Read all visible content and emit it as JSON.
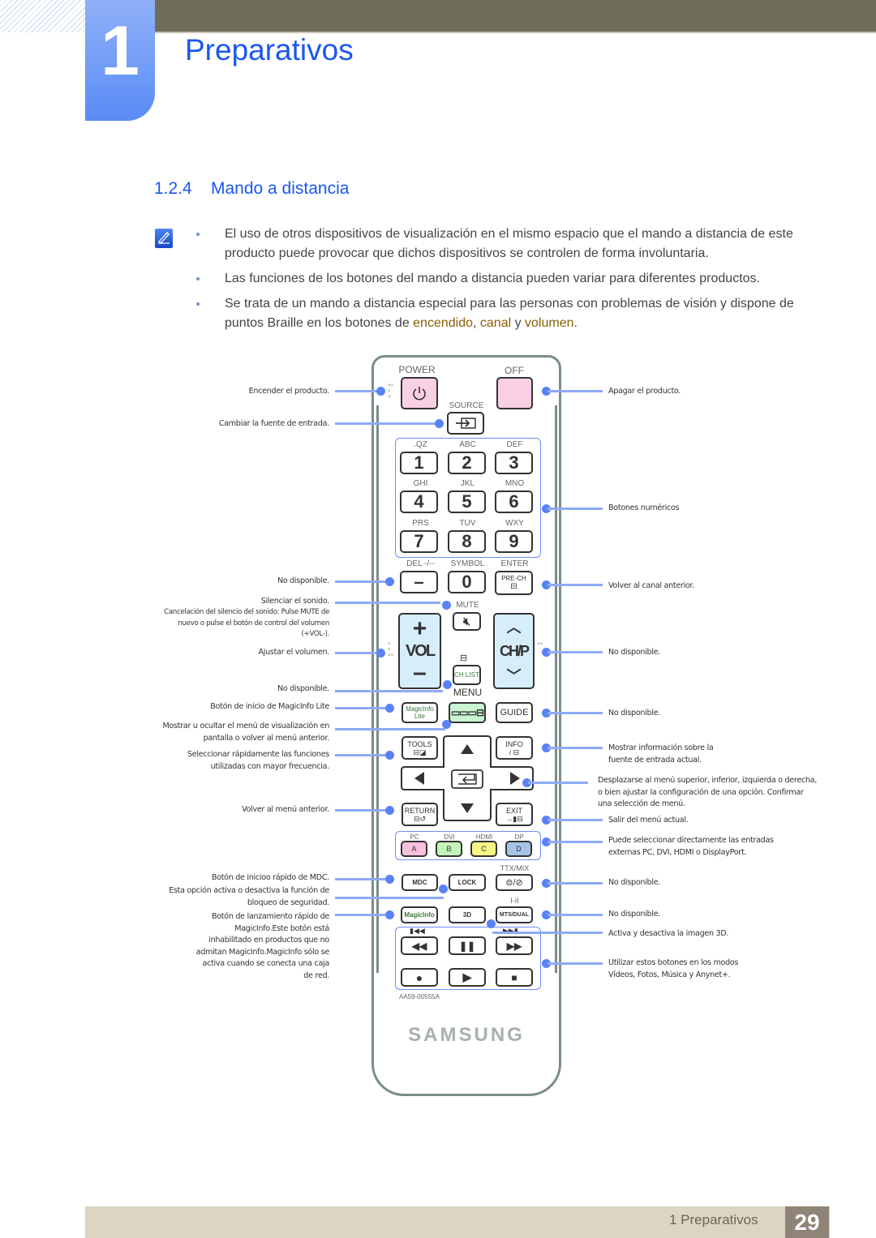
{
  "header": {
    "chapter_number": "1",
    "chapter_title": "Preparativos"
  },
  "section": {
    "number": "1.2.4",
    "title": "Mando a distancia"
  },
  "notes": {
    "icon": "note-pencil-icon",
    "bullets": [
      {
        "text": "El uso de otros dispositivos de visualización en el mismo espacio que el mando a distancia de este producto puede provocar que dichos dispositivos se controlen de forma involuntaria."
      },
      {
        "text": "Las funciones de los botones del mando a distancia pueden variar para diferentes productos."
      },
      {
        "text_before": "Se trata de un mando a distancia especial para las personas con problemas de visión y dispone de puntos Braille en los botones de ",
        "hl1": "encendido",
        "sep1": ", ",
        "hl2": "canal",
        "sep2": " y ",
        "hl3": "volumen",
        "text_after": "."
      }
    ],
    "highlight_color": "#8a5e00"
  },
  "remote": {
    "labels": {
      "power": "POWER",
      "off": "OFF",
      "source": "SOURCE",
      "row1": [
        ".QZ",
        "ABC",
        "DEF"
      ],
      "row2": [
        "GHI",
        "JKL",
        "MNO"
      ],
      "row3": [
        "PRS",
        "TUV",
        "WXY"
      ],
      "del": "DEL -/--",
      "symbol": "SYMBOL",
      "enter": "ENTER",
      "mute": "MUTE",
      "menu": "MENU",
      "ttx": "TTX/MIX",
      "i_ii": "I-II",
      "pc": "PC",
      "dvi": "DVI",
      "hdmi": "HDMI",
      "dp": "DP"
    },
    "buttons": {
      "digits": [
        "1",
        "2",
        "3",
        "4",
        "5",
        "6",
        "7",
        "8",
        "9"
      ],
      "dash": "–",
      "zero": "0",
      "prech": "PRE-CH",
      "vol": "VOL",
      "chp": "CH/P",
      "chlist": "CH LIST",
      "magicinfo_lite": "MagicInfo Lite",
      "guide": "GUIDE",
      "tools": "TOOLS",
      "info": "INFO",
      "return": "RETURN",
      "exit": "EXIT",
      "a": "A",
      "b": "B",
      "c": "C",
      "d": "D",
      "mdc": "MDC",
      "lock": "LOCK",
      "magicinfo": "MagicInfo",
      "three_d": "3D",
      "mts": "MTS/DUAL"
    },
    "colors": {
      "power": "#f9d0e3",
      "vol_ch": "#d6eefa",
      "menu": "#c8f5d2",
      "a": "#f9c0dd",
      "b": "#c3f5b8",
      "c": "#f7f585",
      "d": "#a6c4e6",
      "leader": "#8eaaf5",
      "dot": "#5a82f5"
    },
    "model": "AA59-00555A",
    "brand": "SAMSUNG"
  },
  "callouts_left": [
    "Encender el producto.",
    "Cambiar la fuente de entrada.",
    "No disponible.",
    "Silenciar el sonido.",
    "Cancelación del silencio del sonido: Pulse MUTE de nuevo o pulse el botón de control del volumen (+VOL-).",
    "Ajustar el volumen.",
    "No disponible.",
    "Botón de inicio de MagicInfo Lite",
    "Mostrar u ocultar el menú de visualización en pantalla o volver al menú anterior.",
    "Seleccionar rápidamente las funciones utilizadas con mayor frecuencia.",
    "Volver al menú anterior.",
    "Botón de inicioo rápido de MDC.",
    "Esta opción activa o desactiva la función de bloqueo de seguridad.",
    "Botón de lanzamiento rápido de MagicInfo.Este botón está inhabilitado en productos que no admitan MagicInfo.MagicInfo sólo se activa cuando se conecta una caja de red."
  ],
  "callouts_right": [
    "Apagar el producto.",
    "Botones numéricos",
    "Volver al canal anterior.",
    "No disponible.",
    "No disponible.",
    "Mostrar información sobre la fuente de entrada actual.",
    "Desplazarse al menú superior, inferior, izquierda o derecha, o bien ajustar la configuración de una opción. Confirmar una selección de menú.",
    "Salir del menú actual.",
    "Puede seleccionar directamente las entradas externas PC, DVI, HDMI o DisplayPort.",
    "No disponible.",
    "No disponible.",
    "Activa y desactiva la imagen 3D.",
    "Utilizar estos botones en los modos Vídeos, Fotos, Música y Anynet+."
  ],
  "footer": {
    "label": "1 Preparativos",
    "page": "29"
  }
}
